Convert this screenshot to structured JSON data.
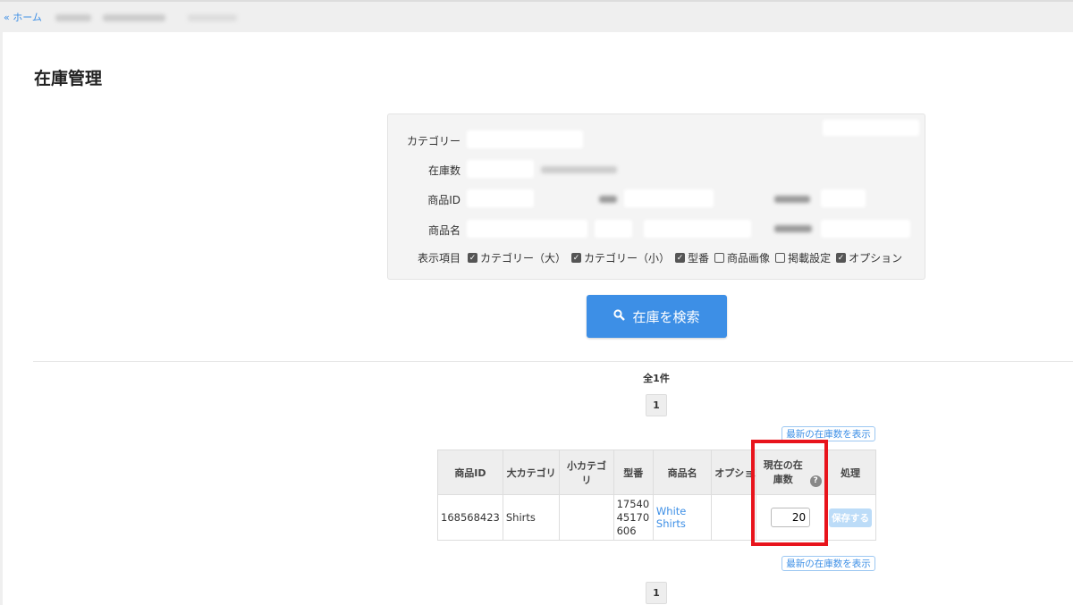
{
  "breadcrumb": {
    "home": "« ホーム"
  },
  "page_title": "在庫管理",
  "filter": {
    "labels": [
      "カテゴリー",
      "在庫数",
      "商品ID",
      "商品名",
      "表示項目"
    ],
    "display_items": [
      {
        "label": "カテゴリー（大）",
        "checked": true
      },
      {
        "label": "カテゴリー（小）",
        "checked": true
      },
      {
        "label": "型番",
        "checked": true
      },
      {
        "label": "商品画像",
        "checked": false
      },
      {
        "label": "掲載設定",
        "checked": false
      },
      {
        "label": "オプション",
        "checked": true
      }
    ]
  },
  "search_button": "在庫を検索",
  "result_count": "全1件",
  "pagination": {
    "current": "1"
  },
  "latest_stock_button": "最新の在庫数を表示",
  "table": {
    "headers": [
      "商品ID",
      "大カテゴリ",
      "小カテゴリ",
      "型番",
      "商品名",
      "オプション",
      "現在の在庫数",
      "処理"
    ],
    "rows": [
      {
        "id": "168568423",
        "major": "Shirts",
        "minor": "",
        "model": "1754045170606",
        "name": "White Shirts",
        "option": "",
        "stock": "20",
        "action": "保存する"
      }
    ]
  },
  "colors": {
    "accent": "#3d8fe6",
    "highlight": "#e8141c"
  }
}
